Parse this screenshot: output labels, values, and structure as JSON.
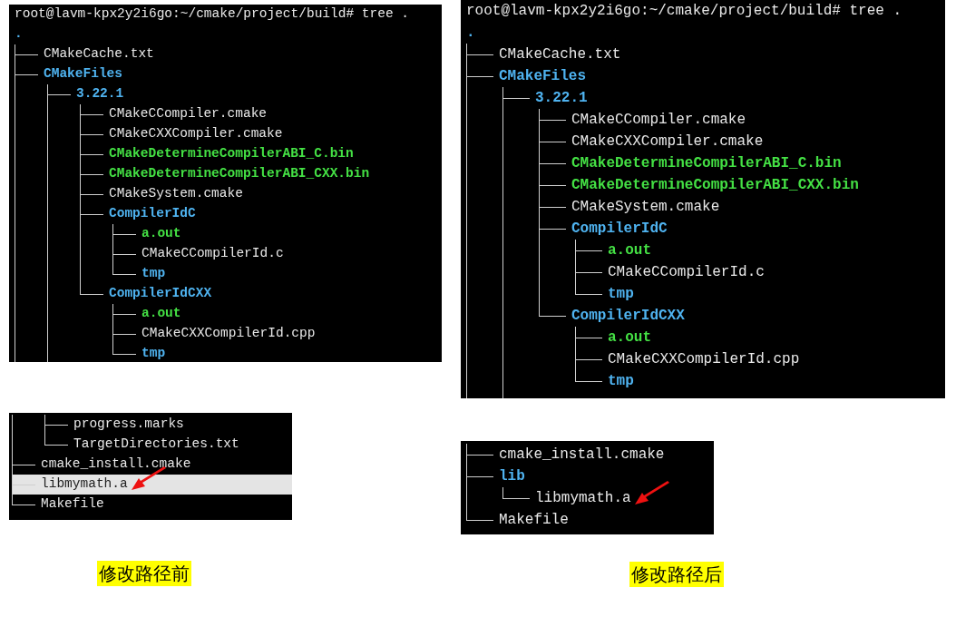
{
  "columns": [
    {
      "panels": [
        {
          "prompt": "root@lavm-kpx2y2i6go:~/cmake/project/build# tree .",
          "root": ".",
          "entries": [
            {
              "name": "CMakeCache.txt",
              "kind": "file"
            },
            {
              "name": "CMakeFiles",
              "kind": "dir",
              "continues": true,
              "children": [
                {
                  "name": "3.22.1",
                  "kind": "dir",
                  "continues": true,
                  "children": [
                    {
                      "name": "CMakeCCompiler.cmake",
                      "kind": "file"
                    },
                    {
                      "name": "CMakeCXXCompiler.cmake",
                      "kind": "file"
                    },
                    {
                      "name": "CMakeDetermineCompilerABI_C.bin",
                      "kind": "exec"
                    },
                    {
                      "name": "CMakeDetermineCompilerABI_CXX.bin",
                      "kind": "exec"
                    },
                    {
                      "name": "CMakeSystem.cmake",
                      "kind": "file"
                    },
                    {
                      "name": "CompilerIdC",
                      "kind": "dir",
                      "children": [
                        {
                          "name": "a.out",
                          "kind": "exec"
                        },
                        {
                          "name": "CMakeCCompilerId.c",
                          "kind": "file"
                        },
                        {
                          "name": "tmp",
                          "kind": "dir"
                        }
                      ]
                    },
                    {
                      "name": "CompilerIdCXX",
                      "kind": "dir",
                      "children": [
                        {
                          "name": "a.out",
                          "kind": "exec"
                        },
                        {
                          "name": "CMakeCXXCompilerId.cpp",
                          "kind": "file"
                        },
                        {
                          "name": "tmp",
                          "kind": "dir"
                        }
                      ]
                    }
                  ]
                }
              ]
            }
          ]
        },
        {
          "entries": [
            {
              "children": [
                {
                  "name": "progress.marks",
                  "kind": "file"
                },
                {
                  "name": "TargetDirectories.txt",
                  "kind": "file"
                }
              ]
            },
            {
              "name": "cmake_install.cmake",
              "kind": "file"
            },
            {
              "name": "libmymath.a",
              "kind": "file",
              "selected": true,
              "arrow": true
            },
            {
              "name": "Makefile",
              "kind": "file"
            }
          ]
        }
      ],
      "caption": "修改路径前"
    },
    {
      "panels": [
        {
          "prompt": "root@lavm-kpx2y2i6go:~/cmake/project/build# tree .",
          "root": ".",
          "entries": [
            {
              "name": "CMakeCache.txt",
              "kind": "file"
            },
            {
              "name": "CMakeFiles",
              "kind": "dir",
              "continues": true,
              "children": [
                {
                  "name": "3.22.1",
                  "kind": "dir",
                  "continues": true,
                  "children": [
                    {
                      "name": "CMakeCCompiler.cmake",
                      "kind": "file"
                    },
                    {
                      "name": "CMakeCXXCompiler.cmake",
                      "kind": "file"
                    },
                    {
                      "name": "CMakeDetermineCompilerABI_C.bin",
                      "kind": "exec"
                    },
                    {
                      "name": "CMakeDetermineCompilerABI_CXX.bin",
                      "kind": "exec"
                    },
                    {
                      "name": "CMakeSystem.cmake",
                      "kind": "file"
                    },
                    {
                      "name": "CompilerIdC",
                      "kind": "dir",
                      "children": [
                        {
                          "name": "a.out",
                          "kind": "exec"
                        },
                        {
                          "name": "CMakeCCompilerId.c",
                          "kind": "file"
                        },
                        {
                          "name": "tmp",
                          "kind": "dir"
                        }
                      ]
                    },
                    {
                      "name": "CompilerIdCXX",
                      "kind": "dir",
                      "children": [
                        {
                          "name": "a.out",
                          "kind": "exec"
                        },
                        {
                          "name": "CMakeCXXCompilerId.cpp",
                          "kind": "file"
                        },
                        {
                          "name": "tmp",
                          "kind": "dir"
                        }
                      ]
                    }
                  ]
                }
              ]
            }
          ]
        },
        {
          "entries": [
            {
              "name": "cmake_install.cmake",
              "kind": "file"
            },
            {
              "name": "lib",
              "kind": "dir",
              "children": [
                {
                  "name": "libmymath.a",
                  "kind": "file",
                  "arrow": true
                }
              ]
            },
            {
              "name": "Makefile",
              "kind": "file"
            }
          ]
        }
      ],
      "caption": "修改路径后"
    }
  ]
}
